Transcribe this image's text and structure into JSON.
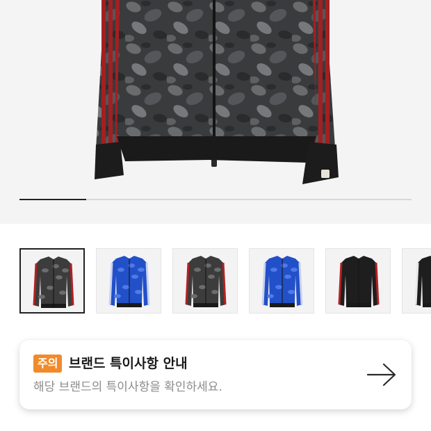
{
  "hero": {
    "product_image": "bape-camo-track-jacket-black-red",
    "carousel_progress": 0.17
  },
  "thumbnails": [
    {
      "name": "thumb-camo-black-red",
      "selected": true,
      "body": "#3c3c3c",
      "stripe": "#b32121",
      "camo": true
    },
    {
      "name": "thumb-camo-blue",
      "selected": false,
      "body": "#2250c8",
      "stripe": "#c9d3ee",
      "camo": true
    },
    {
      "name": "thumb-camo-black-red-2",
      "selected": false,
      "body": "#3c3c3c",
      "stripe": "#b32121",
      "camo": true
    },
    {
      "name": "thumb-camo-blue-2",
      "selected": false,
      "body": "#2250c8",
      "stripe": "#c9d3ee",
      "camo": true
    },
    {
      "name": "thumb-black-red",
      "selected": false,
      "body": "#1e1e1e",
      "stripe": "#b32121",
      "camo": false
    },
    {
      "name": "thumb-black-white",
      "selected": false,
      "body": "#1e1e1e",
      "stripe": "#e8e8e8",
      "camo": false
    }
  ],
  "notice": {
    "badge": "주의",
    "title": "브랜드 특이사항 안내",
    "subtitle": "해당 브랜드의 특이사항을 확인하세요.",
    "arrow_icon": "arrow-right-icon"
  },
  "colors": {
    "badge": "#f08a2b",
    "stripe_red": "#b32121"
  }
}
